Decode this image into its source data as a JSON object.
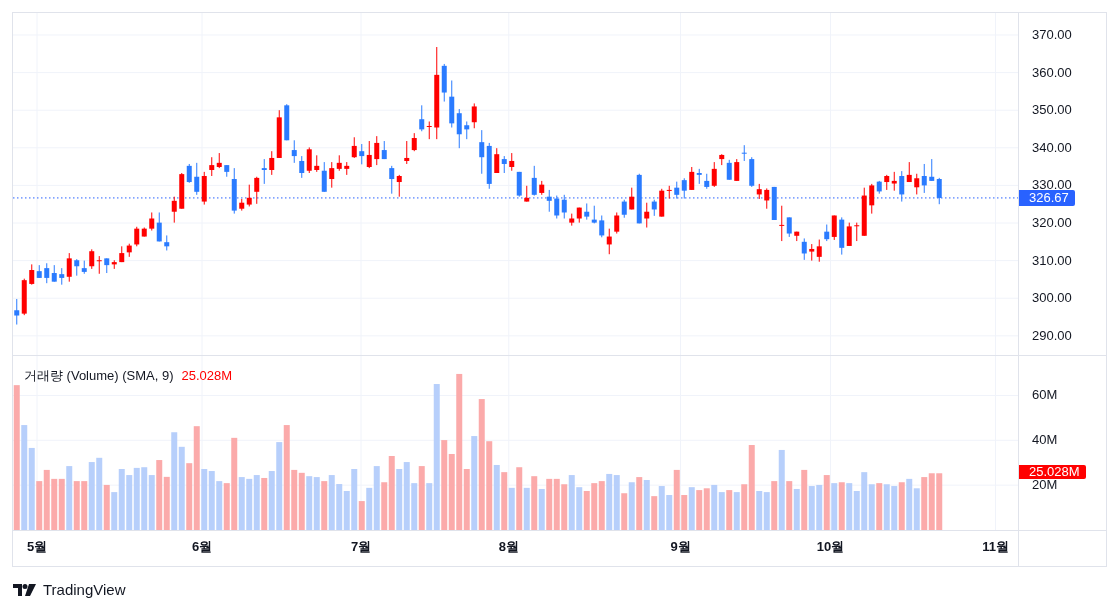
{
  "price_pane": {
    "chart_data": {
      "type": "candlestick",
      "grid": true,
      "ylim": [
        284.9,
        375.85
      ],
      "ref_lines": [
        {
          "axis": "y",
          "value": 326.67,
          "label": "326.67"
        }
      ],
      "yticks": [
        {
          "value": 370,
          "label": "370.00"
        },
        {
          "value": 360,
          "label": "360.00"
        },
        {
          "value": 350,
          "label": "350.00"
        },
        {
          "value": 340,
          "label": "340.00"
        },
        {
          "value": 330,
          "label": "330.00"
        },
        {
          "value": 320,
          "label": "320.00"
        },
        {
          "value": 310,
          "label": "310.00"
        },
        {
          "value": 300,
          "label": "300.00"
        },
        {
          "value": 290,
          "label": "290.00"
        }
      ],
      "categories": [
        null,
        null,
        null,
        null,
        null,
        null,
        null,
        null,
        null,
        null,
        null,
        null,
        null,
        null,
        null,
        null,
        null,
        null,
        null,
        null,
        null,
        null,
        null,
        null,
        null,
        null,
        null,
        null,
        null,
        null,
        null,
        null,
        null,
        null,
        null,
        null,
        null,
        null,
        null,
        null,
        null,
        null,
        null,
        null,
        null,
        null,
        null,
        null,
        null,
        null,
        null,
        null,
        null,
        null,
        null,
        null,
        null,
        null,
        null,
        null,
        null,
        null,
        null,
        null,
        null,
        null,
        null,
        null,
        null,
        null,
        null,
        null,
        null,
        null,
        null,
        null,
        null,
        null,
        null,
        null,
        null,
        null,
        null,
        null,
        null,
        null,
        null,
        null,
        null,
        null,
        null,
        null,
        null,
        null,
        null,
        null,
        null,
        null,
        null,
        null,
        null,
        null,
        null,
        null,
        null,
        null,
        null,
        null,
        null,
        null,
        null,
        null,
        null,
        null,
        null,
        null,
        null,
        null,
        null,
        null,
        null,
        null,
        null,
        null,
        null,
        null,
        null,
        null,
        null,
        null,
        null,
        null,
        null,
        null
      ],
      "ohlc": [
        [
          296.8,
          299.8,
          293.0,
          295.4
        ],
        [
          295.9,
          305.2,
          295.5,
          304.8
        ],
        [
          303.8,
          309.0,
          303.6,
          307.5
        ],
        [
          307.2,
          308.8,
          305.4,
          305.4
        ],
        [
          308.0,
          309.3,
          304.0,
          305.4
        ],
        [
          306.7,
          308.8,
          304.4,
          304.4
        ],
        [
          306.4,
          308.0,
          303.6,
          305.4
        ],
        [
          305.7,
          312.0,
          304.4,
          310.6
        ],
        [
          310.1,
          310.4,
          306.0,
          308.5
        ],
        [
          308.0,
          310.0,
          306.5,
          307.0
        ],
        [
          308.5,
          313.0,
          307.8,
          312.5
        ],
        [
          310.0,
          311.2,
          306.5,
          310.1
        ],
        [
          310.6,
          310.6,
          306.7,
          308.8
        ],
        [
          309.0,
          310.1,
          307.8,
          309.6
        ],
        [
          309.6,
          313.8,
          309.6,
          312.0
        ],
        [
          312.2,
          314.5,
          311.0,
          314.0
        ],
        [
          314.3,
          319.0,
          313.8,
          318.5
        ],
        [
          316.4,
          318.8,
          316.4,
          318.5
        ],
        [
          318.5,
          322.8,
          318.0,
          321.2
        ],
        [
          320.1,
          322.8,
          315.1,
          315.1
        ],
        [
          314.9,
          316.7,
          312.7,
          313.8
        ],
        [
          323.0,
          327.0,
          320.1,
          325.9
        ],
        [
          323.8,
          333.3,
          323.8,
          333.0
        ],
        [
          335.2,
          335.7,
          330.7,
          330.9
        ],
        [
          332.3,
          336.0,
          327.5,
          328.3
        ],
        [
          325.7,
          333.6,
          324.9,
          332.5
        ],
        [
          334.1,
          337.5,
          332.5,
          335.4
        ],
        [
          334.9,
          338.6,
          334.6,
          336.0
        ],
        [
          335.4,
          335.4,
          332.3,
          333.6
        ],
        [
          331.7,
          334.6,
          322.5,
          323.3
        ],
        [
          323.8,
          326.4,
          323.3,
          325.4
        ],
        [
          324.9,
          330.2,
          324.4,
          326.7
        ],
        [
          328.3,
          332.3,
          325.1,
          332.0
        ],
        [
          334.6,
          337.0,
          330.4,
          334.1
        ],
        [
          334.1,
          339.1,
          332.8,
          337.3
        ],
        [
          337.3,
          350.0,
          337.3,
          348.1
        ],
        [
          351.3,
          351.6,
          342.0,
          342.0
        ],
        [
          339.4,
          342.0,
          336.0,
          337.8
        ],
        [
          336.5,
          337.8,
          332.0,
          333.3
        ],
        [
          333.9,
          340.1,
          333.3,
          339.6
        ],
        [
          334.1,
          338.0,
          333.6,
          335.2
        ],
        [
          333.9,
          336.2,
          328.3,
          328.3
        ],
        [
          331.7,
          336.2,
          329.4,
          334.6
        ],
        [
          334.4,
          338.0,
          333.9,
          336.0
        ],
        [
          334.4,
          336.2,
          332.8,
          335.2
        ],
        [
          337.5,
          342.8,
          337.3,
          340.5
        ],
        [
          339.1,
          341.0,
          335.6,
          337.8
        ],
        [
          334.9,
          341.8,
          334.6,
          338.1
        ],
        [
          337.0,
          343.1,
          335.4,
          341.3
        ],
        [
          339.4,
          341.8,
          337.0,
          337.0
        ],
        [
          334.6,
          335.2,
          327.8,
          331.7
        ],
        [
          330.9,
          332.8,
          327.0,
          332.5
        ],
        [
          336.5,
          341.8,
          335.7,
          337.3
        ],
        [
          339.4,
          343.9,
          339.1,
          342.6
        ],
        [
          347.6,
          351.3,
          344.4,
          344.9
        ],
        [
          345.6,
          347.0,
          342.3,
          345.8
        ],
        [
          345.4,
          366.8,
          342.3,
          359.4
        ],
        [
          361.8,
          362.3,
          352.3,
          354.7
        ],
        [
          353.6,
          357.9,
          345.4,
          346.5
        ],
        [
          349.2,
          350.3,
          339.9,
          343.6
        ],
        [
          346.0,
          347.0,
          342.3,
          344.9
        ],
        [
          346.8,
          351.8,
          345.2,
          351.0
        ],
        [
          341.5,
          344.7,
          333.1,
          337.5
        ],
        [
          340.5,
          341.3,
          329.1,
          330.4
        ],
        [
          333.3,
          339.9,
          333.3,
          338.3
        ],
        [
          337.0,
          337.8,
          333.3,
          335.7
        ],
        [
          334.9,
          338.6,
          333.9,
          336.5
        ],
        [
          333.6,
          333.6,
          327.0,
          327.3
        ],
        [
          325.7,
          329.9,
          325.7,
          326.7
        ],
        [
          332.0,
          335.2,
          327.3,
          327.5
        ],
        [
          328.0,
          331.2,
          327.5,
          330.2
        ],
        [
          327.0,
          328.8,
          323.0,
          325.9
        ],
        [
          326.5,
          327.3,
          321.2,
          322.0
        ],
        [
          326.2,
          327.5,
          321.2,
          322.8
        ],
        [
          320.1,
          322.5,
          319.3,
          321.2
        ],
        [
          321.2,
          324.1,
          320.1,
          324.1
        ],
        [
          323.0,
          325.2,
          320.9,
          321.7
        ],
        [
          320.9,
          324.6,
          319.9,
          320.1
        ],
        [
          320.7,
          322.0,
          316.2,
          316.7
        ],
        [
          314.3,
          318.5,
          311.7,
          316.4
        ],
        [
          317.7,
          322.8,
          317.2,
          322.0
        ],
        [
          325.7,
          326.2,
          321.4,
          322.2
        ],
        [
          323.6,
          329.4,
          323.6,
          327.0
        ],
        [
          332.8,
          333.1,
          319.9,
          319.9
        ],
        [
          321.2,
          325.4,
          318.8,
          323.0
        ],
        [
          325.7,
          326.2,
          321.9,
          323.6
        ],
        [
          321.7,
          329.1,
          321.7,
          328.6
        ],
        [
          328.7,
          329.9,
          326.5,
          328.8
        ],
        [
          329.4,
          331.0,
          326.5,
          327.5
        ],
        [
          331.4,
          331.9,
          326.5,
          328.6
        ],
        [
          328.8,
          334.9,
          328.8,
          333.6
        ],
        [
          333.3,
          334.4,
          330.4,
          332.8
        ],
        [
          331.2,
          333.1,
          329.1,
          329.6
        ],
        [
          329.9,
          336.2,
          329.6,
          334.4
        ],
        [
          337.0,
          338.3,
          335.4,
          338.1
        ],
        [
          336.0,
          336.8,
          331.5,
          331.5
        ],
        [
          331.2,
          337.0,
          331.2,
          336.2
        ],
        [
          338.7,
          340.7,
          336.5,
          338.6
        ],
        [
          337.0,
          337.5,
          329.6,
          329.9
        ],
        [
          327.6,
          330.4,
          326.4,
          329.0
        ],
        [
          326.0,
          329.2,
          323.8,
          328.8
        ],
        [
          329.6,
          329.6,
          320.8,
          320.8
        ],
        [
          319.3,
          324.6,
          315.2,
          319.5
        ],
        [
          321.5,
          321.5,
          316.3,
          317.2
        ],
        [
          316.6,
          317.7,
          315.2,
          317.7
        ],
        [
          315.0,
          315.9,
          310.2,
          311.9
        ],
        [
          312.4,
          314.4,
          310.0,
          313.1
        ],
        [
          311.0,
          315.6,
          309.7,
          313.8
        ],
        [
          317.7,
          319.6,
          315.2,
          315.7
        ],
        [
          316.3,
          322.0,
          315.5,
          322.0
        ],
        [
          320.9,
          321.5,
          311.6,
          313.4
        ],
        [
          313.9,
          320.1,
          313.9,
          319.1
        ],
        [
          319.2,
          320.1,
          315.2,
          319.4
        ],
        [
          316.6,
          329.4,
          316.6,
          327.3
        ],
        [
          324.7,
          330.4,
          322.5,
          330.0
        ],
        [
          331.0,
          331.2,
          327.8,
          328.4
        ],
        [
          330.9,
          332.8,
          328.8,
          332.5
        ],
        [
          330.5,
          333.6,
          328.6,
          331.2
        ],
        [
          332.5,
          333.8,
          325.7,
          327.6
        ],
        [
          330.9,
          336.2,
          330.9,
          332.8
        ],
        [
          329.5,
          333.1,
          327.6,
          331.9
        ],
        [
          332.5,
          335.7,
          328.0,
          330.0
        ],
        [
          332.3,
          337.0,
          331.2,
          331.2
        ],
        [
          331.7,
          332.0,
          325.0,
          326.67
        ],
        null,
        null,
        null,
        null,
        null,
        null,
        null,
        null,
        null,
        null
      ]
    }
  },
  "volume_pane": {
    "legend": {
      "title": "거래량 (Volume) (SMA, 9)",
      "value": "25.028M"
    },
    "chart_data": {
      "type": "bar",
      "grid": true,
      "ylim": [
        0,
        77.6
      ],
      "yticks": [
        {
          "value": 60,
          "label": "60M"
        },
        {
          "value": 40,
          "label": "40M"
        },
        {
          "value": 20,
          "label": "20M"
        }
      ],
      "categories": [
        null,
        null,
        null,
        null,
        null,
        null,
        null,
        null,
        null,
        null,
        null,
        null,
        null,
        null,
        null,
        null,
        null,
        null,
        null,
        null,
        null,
        null,
        null,
        null,
        null,
        null,
        null,
        null,
        null,
        null,
        null,
        null,
        null,
        null,
        null,
        null,
        null,
        null,
        null,
        null,
        null,
        null,
        null,
        null,
        null,
        null,
        null,
        null,
        null,
        null,
        null,
        null,
        null,
        null,
        null,
        null,
        null,
        null,
        null,
        null,
        null,
        null,
        null,
        null,
        null,
        null,
        null,
        null,
        null,
        null,
        null,
        null,
        null,
        null,
        null,
        null,
        null,
        null,
        null,
        null,
        null,
        null,
        null,
        null,
        null,
        null,
        null,
        null,
        null,
        null,
        null,
        null,
        null,
        null,
        null,
        null,
        null,
        null,
        null,
        null,
        null,
        null,
        null,
        null,
        null,
        null,
        null,
        null,
        null,
        null,
        null,
        null,
        null,
        null,
        null,
        null,
        null,
        null,
        null,
        null,
        null,
        null,
        null,
        null,
        null,
        null,
        null,
        null,
        null,
        null,
        null,
        null,
        null,
        null
      ],
      "series": [
        {
          "color": "#fbaaaa",
          "values": [
            64.6,
            null,
            null,
            21.8,
            26.8,
            22.8,
            22.8,
            null,
            21.8,
            21.8,
            null,
            null,
            20.1,
            null,
            null,
            null,
            null,
            null,
            null,
            31.2,
            23.7,
            null,
            null,
            29.8,
            46.3,
            null,
            null,
            null,
            20.9,
            41.1,
            null,
            null,
            null,
            23.2,
            null,
            null,
            46.8,
            26.8,
            25.5,
            null,
            null,
            21.8,
            null,
            null,
            null,
            null,
            12.9,
            null,
            null,
            21.3,
            33.0,
            null,
            null,
            null,
            28.5,
            null,
            null,
            40.1,
            33.9,
            69.6,
            27.2,
            null,
            58.4,
            39.6,
            null,
            25.8,
            null,
            28.0,
            null,
            24.0,
            null,
            22.8,
            22.8,
            20.4,
            null,
            null,
            17.4,
            20.9,
            21.8,
            null,
            null,
            16.4,
            null,
            23.6,
            null,
            15.1,
            null,
            null,
            26.8,
            15.6,
            null,
            17.8,
            18.6,
            null,
            null,
            17.8,
            null,
            20.4,
            37.9,
            null,
            null,
            21.8,
            null,
            21.8,
            null,
            26.8,
            null,
            null,
            24.5,
            null,
            21.3,
            null,
            null,
            null,
            null,
            20.9,
            null,
            null,
            21.3,
            null,
            null,
            23.6,
            25.3,
            25.3,
            null,
            null,
            null,
            null,
            null,
            null,
            null,
            null,
            null,
            null
          ]
        },
        {
          "color": "#b7cffb",
          "values": [
            null,
            46.8,
            36.6,
            null,
            null,
            null,
            null,
            28.5,
            null,
            null,
            30.3,
            32.2,
            null,
            16.9,
            27.2,
            24.5,
            27.7,
            28.0,
            24.5,
            null,
            null,
            43.6,
            37.1,
            null,
            null,
            27.2,
            26.3,
            21.8,
            null,
            null,
            23.6,
            22.8,
            24.5,
            null,
            26.3,
            39.2,
            null,
            null,
            null,
            24.0,
            23.6,
            null,
            24.5,
            20.5,
            17.4,
            27.2,
            null,
            18.8,
            28.5,
            null,
            null,
            27.2,
            30.3,
            20.9,
            null,
            20.9,
            65.1,
            null,
            null,
            null,
            null,
            41.9,
            null,
            null,
            29.0,
            null,
            18.8,
            null,
            18.8,
            null,
            18.3,
            null,
            null,
            null,
            24.5,
            19.1,
            null,
            null,
            null,
            25.0,
            24.5,
            null,
            21.3,
            null,
            22.3,
            null,
            19.6,
            15.6,
            null,
            null,
            19.1,
            null,
            null,
            20.1,
            16.9,
            null,
            16.9,
            null,
            null,
            17.4,
            16.9,
            null,
            35.7,
            null,
            18.3,
            null,
            19.6,
            20.1,
            null,
            20.9,
            null,
            20.9,
            17.4,
            25.8,
            20.4,
            null,
            20.4,
            19.6,
            null,
            22.8,
            18.6,
            null,
            null,
            null,
            null,
            null,
            null,
            null,
            null,
            null,
            null,
            null,
            null,
            null
          ]
        }
      ]
    },
    "last_value": "25.028M"
  },
  "time_axis": {
    "labels": [
      "5월",
      "6월",
      "7월",
      "8월",
      "9월",
      "10월",
      "11월"
    ]
  },
  "footer": {
    "brand": "TradingView"
  }
}
